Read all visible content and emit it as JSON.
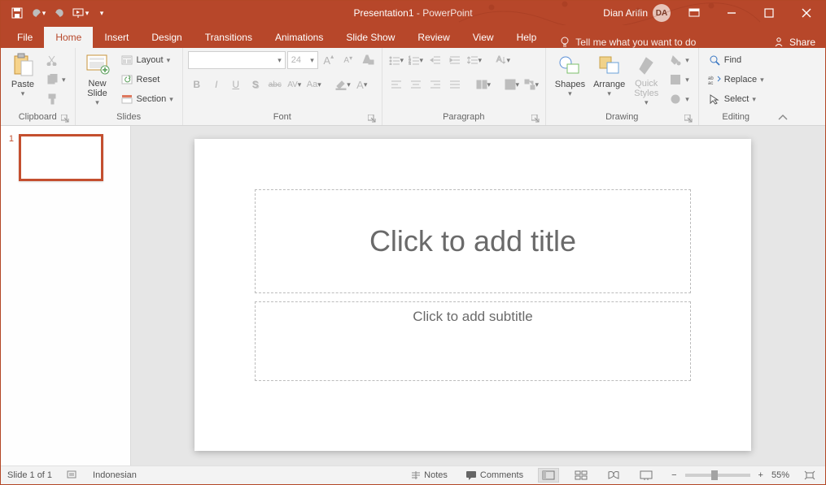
{
  "title": {
    "doc": "Presentation1",
    "app": "PowerPoint"
  },
  "user": {
    "name": "Dian Arifin",
    "initials": "DA"
  },
  "tabs": {
    "file": "File",
    "items": [
      "Home",
      "Insert",
      "Design",
      "Transitions",
      "Animations",
      "Slide Show",
      "Review",
      "View",
      "Help"
    ],
    "active": "Home",
    "tellme": "Tell me what you want to do",
    "share": "Share"
  },
  "ribbon": {
    "clipboard": {
      "label": "Clipboard",
      "paste": "Paste"
    },
    "slides": {
      "label": "Slides",
      "new_slide": "New\nSlide",
      "layout": "Layout",
      "reset": "Reset",
      "section": "Section"
    },
    "font": {
      "label": "Font",
      "font_name": "",
      "font_size": "24",
      "bold": "B",
      "italic": "I",
      "underline": "U",
      "shadow": "S",
      "strike": "abc",
      "spacing": "AV",
      "case": "Aa",
      "clear": "A"
    },
    "paragraph": {
      "label": "Paragraph"
    },
    "drawing": {
      "label": "Drawing",
      "shapes": "Shapes",
      "arrange": "Arrange",
      "quick": "Quick\nStyles"
    },
    "editing": {
      "label": "Editing",
      "find": "Find",
      "replace": "Replace",
      "select": "Select"
    }
  },
  "slide": {
    "title_placeholder": "Click to add title",
    "subtitle_placeholder": "Click to add subtitle",
    "thumb_number": "1"
  },
  "status": {
    "slide_info": "Slide 1 of 1",
    "language": "Indonesian",
    "notes": "Notes",
    "comments": "Comments",
    "zoom": "55%"
  }
}
